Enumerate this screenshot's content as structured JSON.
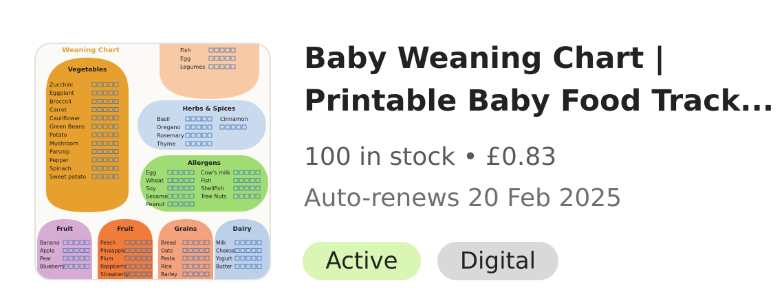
{
  "listing": {
    "title_line1": "Baby Weaning Chart |",
    "title_line2": "Printable Baby Food Track...",
    "stock_text": "100 in stock",
    "separator": "•",
    "price": "£0.83",
    "renew_text": "Auto-renews 20 Feb 2025",
    "badges": {
      "status": "Active",
      "type": "Digital"
    },
    "colors": {
      "active_badge": "#d9f6b4",
      "digital_badge": "#d9d9d9"
    }
  },
  "thumbnail": {
    "heading": "Weaning Chart",
    "vegetables": {
      "title": "Vegetables",
      "items": [
        "Zucchini",
        "Eggplant",
        "Broccoli",
        "Carrot",
        "Cauliflower",
        "Green Beans",
        "Potato",
        "Mushroom",
        "Parsnip",
        "Pepper",
        "Spinach",
        "Sweet potato"
      ]
    },
    "proteins": {
      "items": [
        "Fish",
        "Egg",
        "Legumes"
      ]
    },
    "herbs": {
      "title": "Herbs & Spices",
      "items": [
        "Basil",
        "Oregano",
        "Rosemary",
        "Thyme"
      ],
      "extra": "Cinnamon"
    },
    "allergens": {
      "title": "Allergens",
      "left": [
        "Egg",
        "Wheat",
        "Soy",
        "Sesame",
        "Peanut"
      ],
      "right": [
        "Cow's milk",
        "Fish",
        "Shellfish",
        "Tree Nuts"
      ]
    },
    "fruit1": {
      "title": "Fruit",
      "items": [
        "Banana",
        "Apple",
        "Pear",
        "Blueberry"
      ]
    },
    "fruit2": {
      "title": "Fruit",
      "items": [
        "Peach",
        "Pineapple",
        "Plum",
        "Raspberry",
        "Strawberry"
      ]
    },
    "grains": {
      "title": "Grains",
      "items": [
        "Bread",
        "Oats",
        "Pasta",
        "Rice",
        "Barley"
      ]
    },
    "dairy": {
      "title": "Dairy",
      "items": [
        "Milk",
        "Cheese",
        "Yogurt",
        "Butter"
      ]
    }
  }
}
